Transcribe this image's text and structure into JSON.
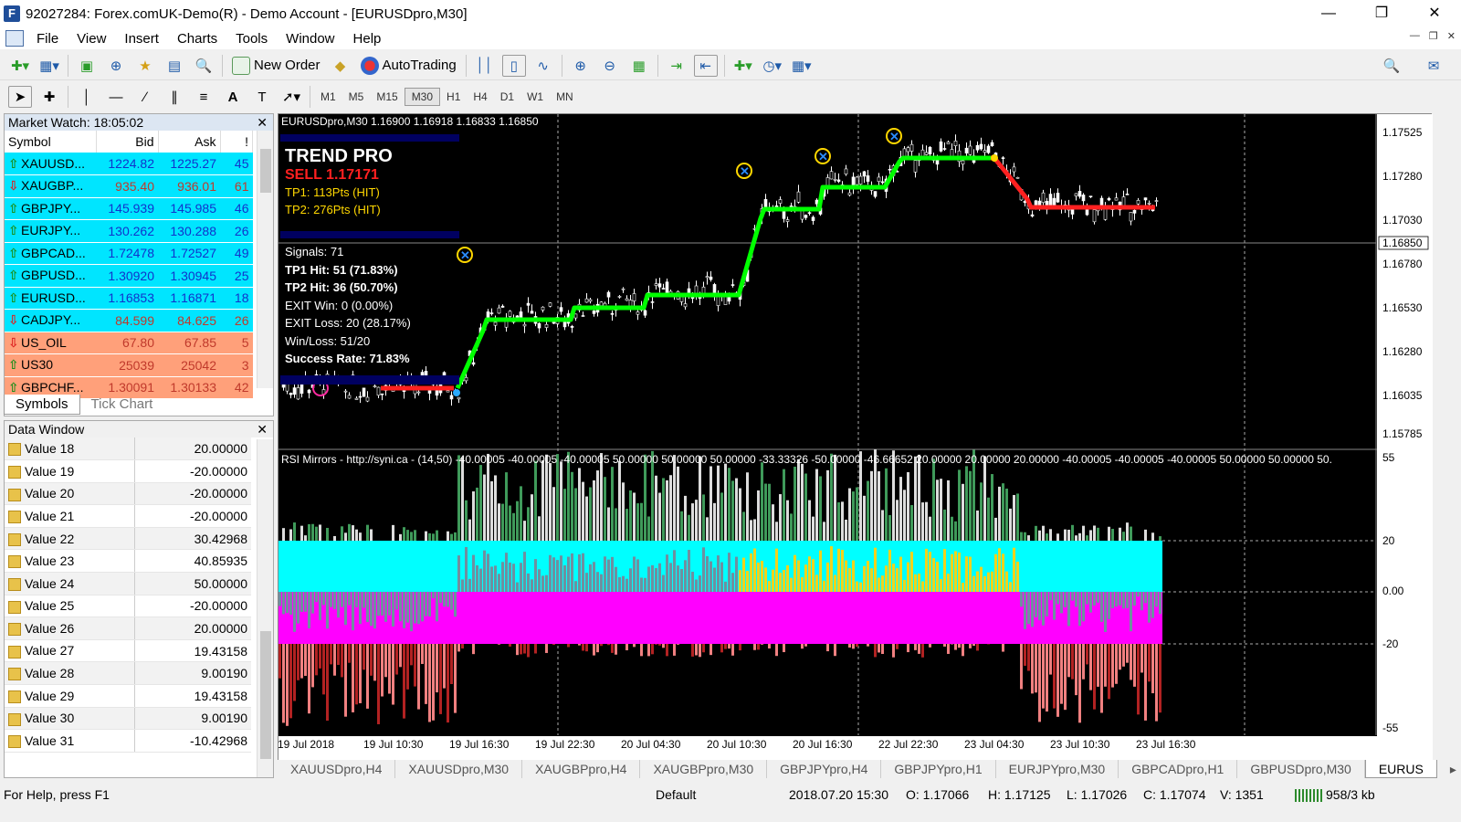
{
  "window": {
    "title": "92027284: Forex.comUK-Demo(R) - Demo Account - [EURUSDpro,M30]",
    "minimize": "—",
    "maximize": "❐",
    "close": "✕",
    "app_icon": "F"
  },
  "menu": [
    "File",
    "View",
    "Insert",
    "Charts",
    "Tools",
    "Window",
    "Help"
  ],
  "toolbar": {
    "new_order": "New Order",
    "autotrading": "AutoTrading"
  },
  "timeframes": [
    "M1",
    "M5",
    "M15",
    "M30",
    "H1",
    "H4",
    "D1",
    "W1",
    "MN"
  ],
  "active_timeframe": "M30",
  "market_watch": {
    "title": "Market Watch: 18:05:02",
    "headers": [
      "Symbol",
      "Bid",
      "Ask",
      "!"
    ],
    "rows": [
      {
        "symbol": "XAUUSD...",
        "bid": "1224.82",
        "ask": "1225.27",
        "spread": "45",
        "dir": "up"
      },
      {
        "symbol": "XAUGBP...",
        "bid": "935.40",
        "ask": "936.01",
        "spread": "61",
        "dir": "down"
      },
      {
        "symbol": "GBPJPY...",
        "bid": "145.939",
        "ask": "145.985",
        "spread": "46",
        "dir": "up"
      },
      {
        "symbol": "EURJPY...",
        "bid": "130.262",
        "ask": "130.288",
        "spread": "26",
        "dir": "up"
      },
      {
        "symbol": "GBPCAD...",
        "bid": "1.72478",
        "ask": "1.72527",
        "spread": "49",
        "dir": "up"
      },
      {
        "symbol": "GBPUSD...",
        "bid": "1.30920",
        "ask": "1.30945",
        "spread": "25",
        "dir": "up"
      },
      {
        "symbol": "EURUSD...",
        "bid": "1.16853",
        "ask": "1.16871",
        "spread": "18",
        "dir": "up"
      },
      {
        "symbol": "CADJPY...",
        "bid": "84.599",
        "ask": "84.625",
        "spread": "26",
        "dir": "down"
      },
      {
        "symbol": "US_OIL",
        "bid": "67.80",
        "ask": "67.85",
        "spread": "5",
        "dir": "down"
      },
      {
        "symbol": "US30",
        "bid": "25039",
        "ask": "25042",
        "spread": "3",
        "dir": "up"
      },
      {
        "symbol": "GBPCHF...",
        "bid": "1.30091",
        "ask": "1.30133",
        "spread": "42",
        "dir": "up"
      }
    ],
    "tabs": [
      "Symbols",
      "Tick Chart"
    ]
  },
  "data_window": {
    "title": "Data Window",
    "rows": [
      {
        "name": "Value 18",
        "value": "20.00000"
      },
      {
        "name": "Value 19",
        "value": "-20.00000"
      },
      {
        "name": "Value 20",
        "value": "-20.00000"
      },
      {
        "name": "Value 21",
        "value": "-20.00000"
      },
      {
        "name": "Value 22",
        "value": "30.42968"
      },
      {
        "name": "Value 23",
        "value": "40.85935"
      },
      {
        "name": "Value 24",
        "value": "50.00000"
      },
      {
        "name": "Value 25",
        "value": "-20.00000"
      },
      {
        "name": "Value 26",
        "value": "20.00000"
      },
      {
        "name": "Value 27",
        "value": "19.43158"
      },
      {
        "name": "Value 28",
        "value": "9.00190"
      },
      {
        "name": "Value 29",
        "value": "19.43158"
      },
      {
        "name": "Value 30",
        "value": "9.00190"
      },
      {
        "name": "Value 31",
        "value": "-10.42968"
      }
    ]
  },
  "chart": {
    "header": "EURUSDpro,M30  1.16900 1.16918 1.16833 1.16850",
    "current_price": "1.16850",
    "price_labels": [
      "1.17525",
      "1.17280",
      "1.17030",
      "1.16780",
      "1.16530",
      "1.16280",
      "1.16035",
      "1.15785"
    ],
    "time_labels": [
      "19 Jul 2018",
      "19 Jul 10:30",
      "19 Jul 16:30",
      "19 Jul 22:30",
      "20 Jul 04:30",
      "20 Jul 10:30",
      "20 Jul 16:30",
      "22 Jul 22:30",
      "23 Jul 04:30",
      "23 Jul 10:30",
      "23 Jul 16:30"
    ],
    "trend_pro": {
      "title": "TREND PRO",
      "signal": "SELL 1.17171",
      "tp1": "TP1: 113Pts (HIT)",
      "tp2": "TP2: 276Pts (HIT)",
      "signals": "Signals: 71",
      "tp1_hit": "TP1 Hit: 51 (71.83%)",
      "tp2_hit": "TP2 Hit: 36 (50.70%)",
      "exit_win": "EXIT Win: 0 (0.00%)",
      "exit_loss": "EXIT Loss: 20 (28.17%)",
      "win_loss": "Win/Loss: 51/20",
      "success": "Success Rate: 71.83%"
    },
    "rsi": {
      "header": "RSI Mirrors - http://syni.ca - (14,50) -40.00005 -40.00005 -40.00005 50.00000 50.00000 50.00000 -33.33326 -50.00000 -46.66652 20.00000 20.00000 20.00000 -40.00005 -40.00005 -40.00005 50.00000 50.00000 50.",
      "levels": [
        "55",
        "20",
        "0.00",
        "-20",
        "-55"
      ]
    }
  },
  "chart_tabs": [
    "XAUUSDpro,H4",
    "XAUUSDpro,M30",
    "XAUGBPpro,H4",
    "XAUGBPpro,M30",
    "GBPJPYpro,H4",
    "GBPJPYpro,H1",
    "EURJPYpro,M30",
    "GBPCADpro,H1",
    "GBPUSDpro,M30",
    "EURUS"
  ],
  "active_chart_tab": "EURUS",
  "status": {
    "help": "For Help, press F1",
    "profile": "Default",
    "datetime": "2018.07.20 15:30",
    "open": "O: 1.17066",
    "high": "H: 1.17125",
    "low": "L: 1.17026",
    "close": "C: 1.17074",
    "volume": "V: 1351",
    "traffic": "958/3 kb"
  },
  "colors": {
    "up_row": "#00e5ff",
    "down_row": "#ffa07a",
    "bid_up": "#1133cc",
    "trend_green": "#00ff00",
    "trend_red": "#ff0000",
    "rsi_cyan": "#00ffff",
    "rsi_magenta": "#ff00ff",
    "rsi_yellow": "#f2d21b"
  }
}
